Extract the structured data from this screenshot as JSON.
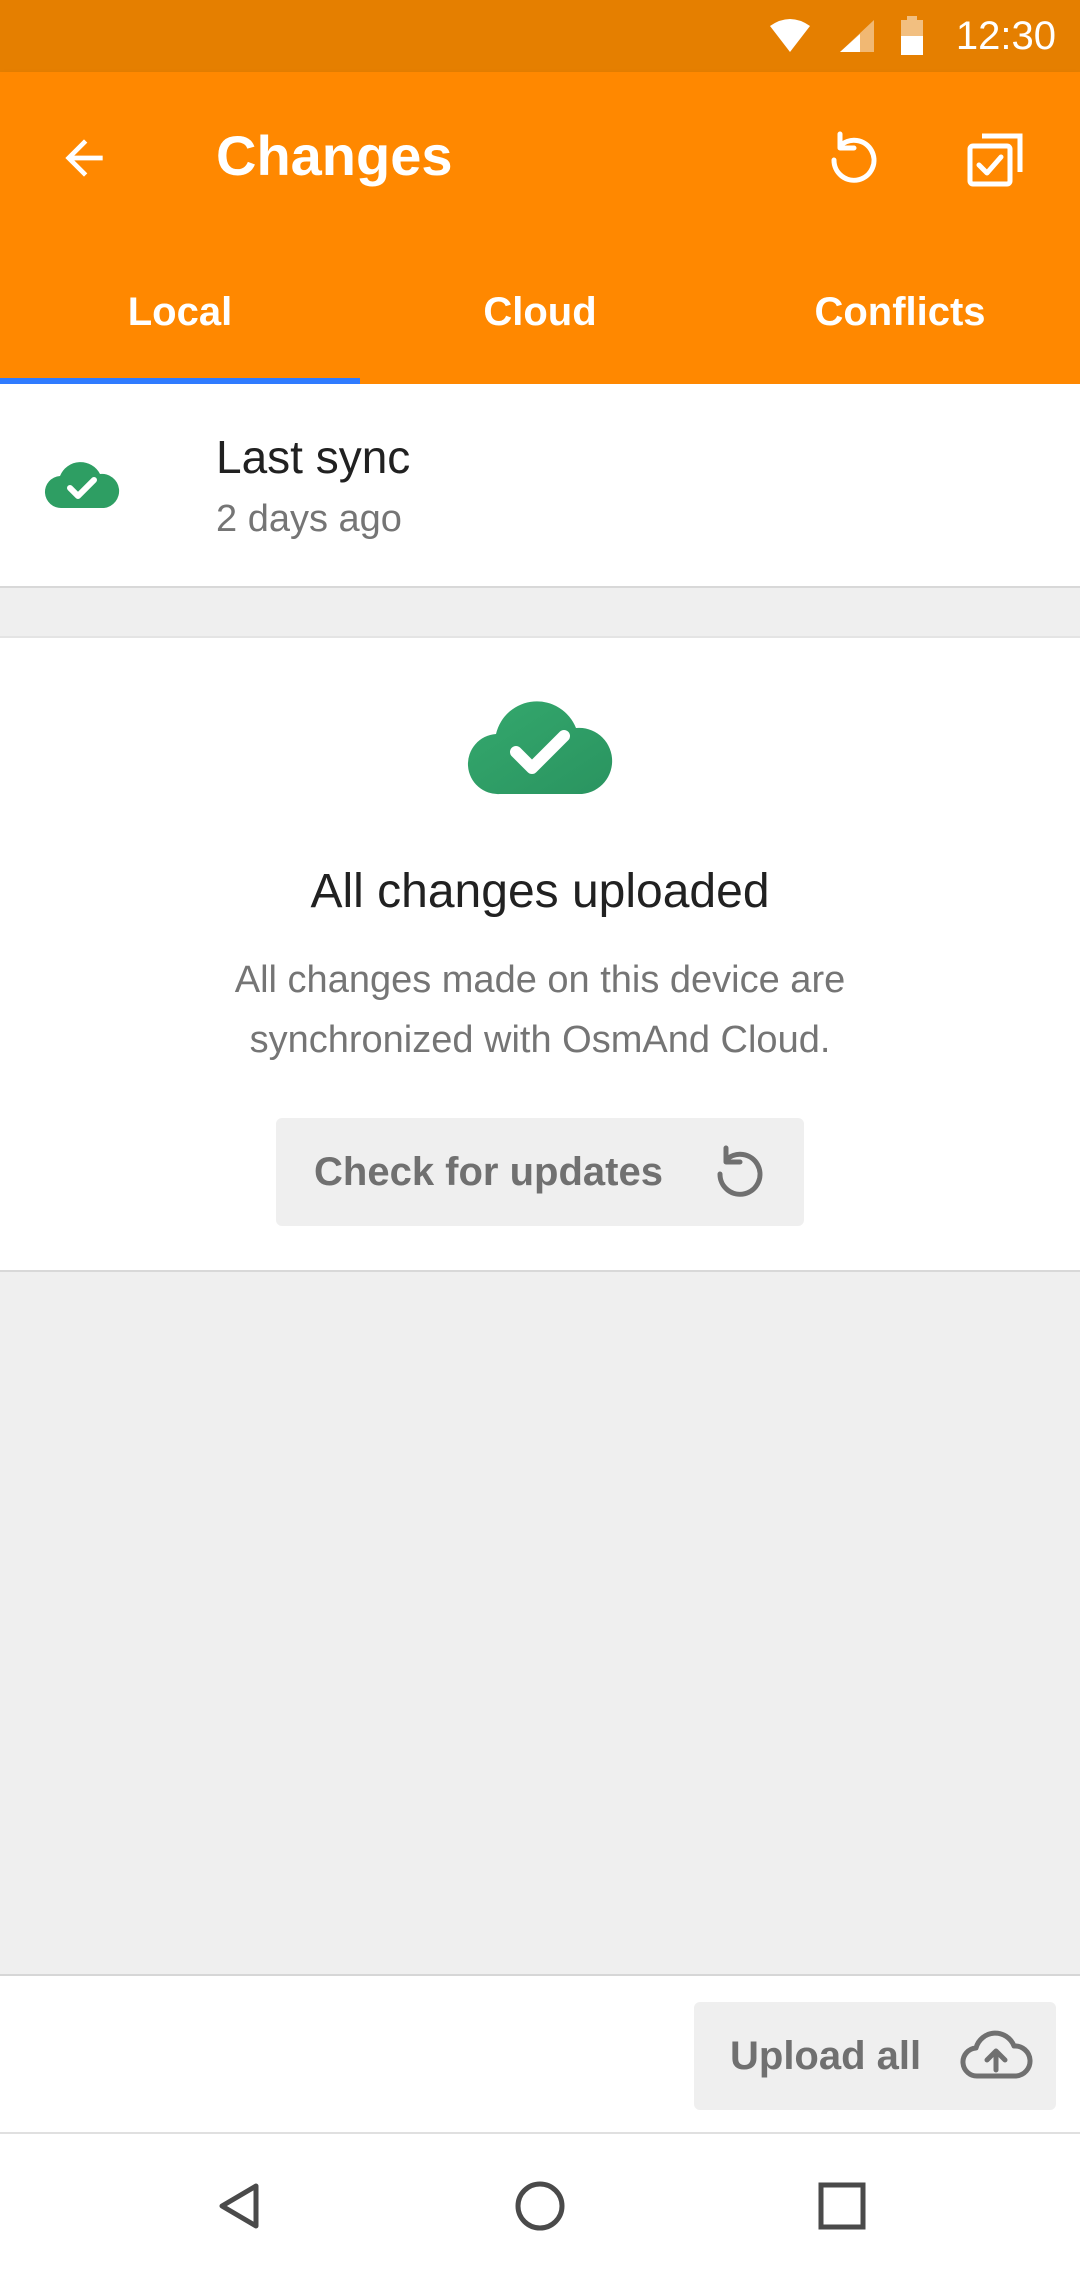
{
  "status_bar": {
    "time": "12:30",
    "icons": [
      "wifi-icon",
      "cellular-signal-icon",
      "battery-icon"
    ]
  },
  "toolbar": {
    "title": "Changes",
    "back_icon": "arrow-left-icon",
    "actions": [
      "refresh-icon",
      "select-all-icon"
    ]
  },
  "tabs": [
    {
      "label": "Local",
      "selected": true
    },
    {
      "label": "Cloud",
      "selected": false
    },
    {
      "label": "Conflicts",
      "selected": false
    }
  ],
  "last_sync": {
    "label": "Last sync",
    "value": "2 days ago",
    "icon": "cloud-check-icon"
  },
  "status": {
    "heading": "All changes uploaded",
    "description": "All changes made on this device are synchronized with OsmAnd Cloud.",
    "check_button_label": "Check for updates",
    "icon": "cloud-check-icon"
  },
  "bottom": {
    "upload_label": "Upload all",
    "upload_icon": "cloud-upload-icon"
  },
  "nav": [
    "back-triangle-icon",
    "home-circle-icon",
    "recents-square-icon"
  ],
  "colors": {
    "app_bar": "#ff8800",
    "status_bar": "#e57f00",
    "tab_indicator": "#2f7bff",
    "success_green": "#2e9e63"
  }
}
